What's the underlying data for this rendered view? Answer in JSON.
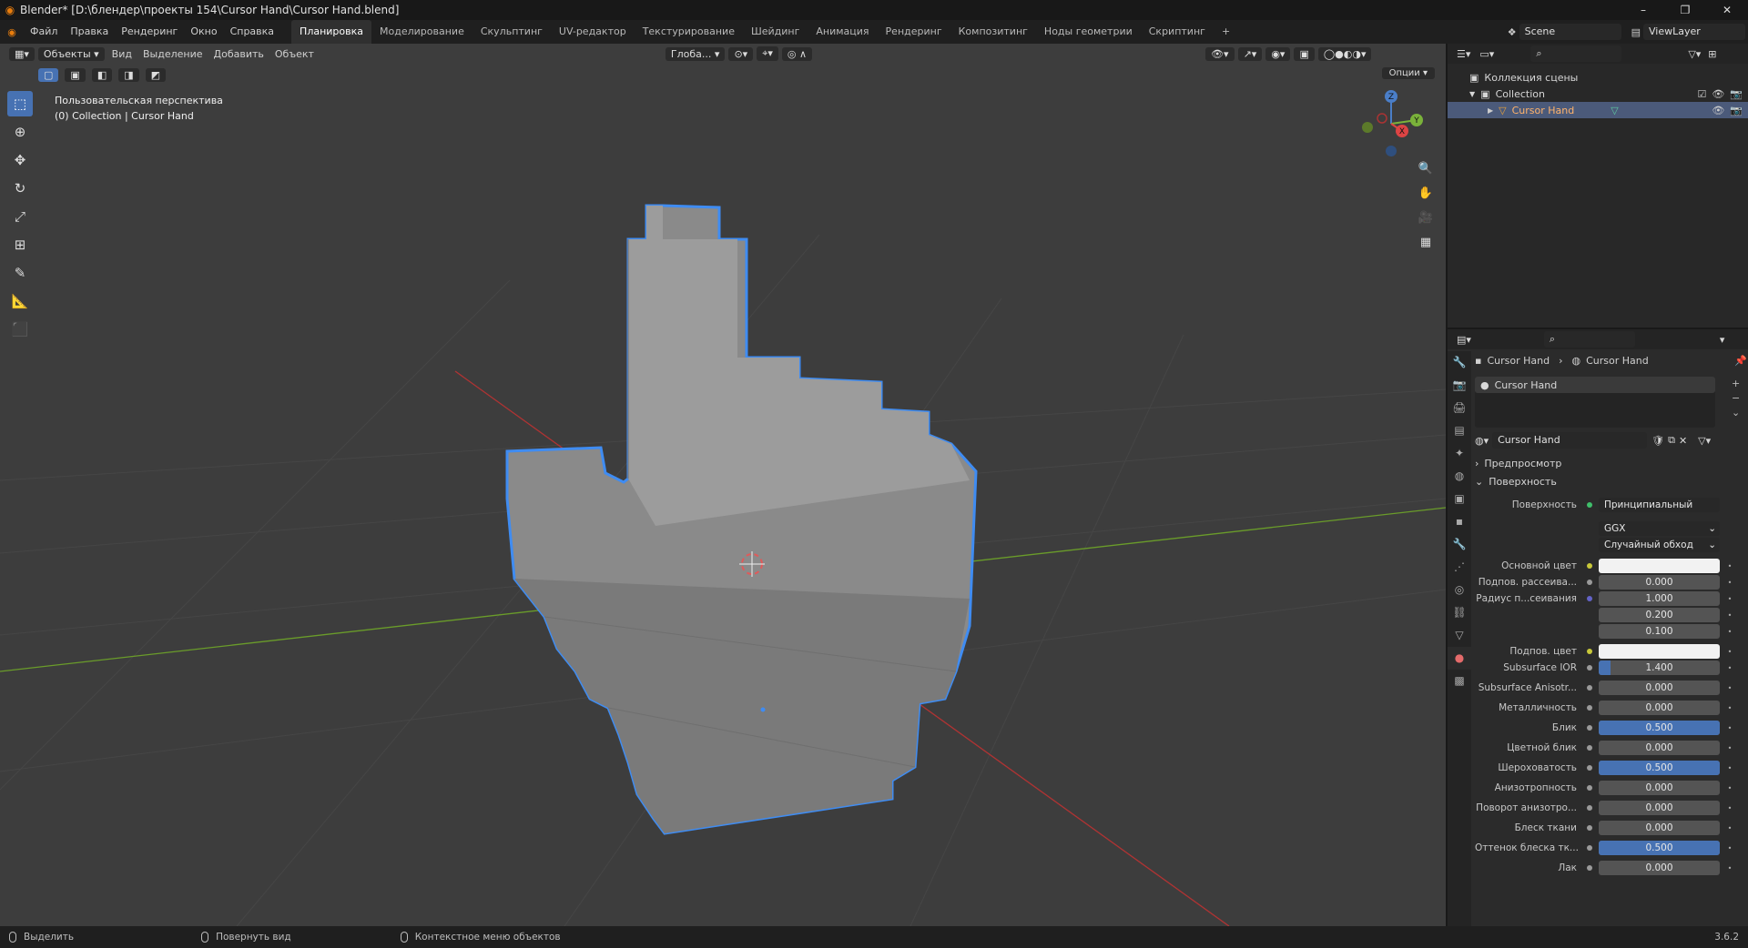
{
  "window": {
    "title": "Blender* [D:\\блендер\\проекты 154\\Cursor Hand\\Cursor Hand.blend]",
    "controls": [
      "–",
      "❐",
      "✕"
    ]
  },
  "menu": {
    "items": [
      "Файл",
      "Правка",
      "Рендеринг",
      "Окно",
      "Справка"
    ],
    "workspaces": [
      "Планировка",
      "Моделирование",
      "Скульптинг",
      "UV-редактор",
      "Текстурирование",
      "Шейдинг",
      "Анимация",
      "Рендеринг",
      "Композитинг",
      "Ноды геометрии",
      "Скриптинг",
      "+"
    ],
    "active_workspace": "Планировка",
    "scene": "Scene",
    "view_layer": "ViewLayer"
  },
  "viewport": {
    "mode": "Объекты",
    "menus": [
      "Вид",
      "Выделение",
      "Добавить",
      "Объект"
    ],
    "orientation": "Глоба...",
    "options": "Опции",
    "perspective_label": "Пользовательская перспектива",
    "collection_label": "(0) Collection | Cursor Hand",
    "gizmo": {
      "x": "X",
      "y": "Y",
      "z": "Z"
    }
  },
  "outliner": {
    "root": "Коллекция сцены",
    "collection": "Collection",
    "object": "Cursor Hand"
  },
  "properties": {
    "breadcrumb": [
      "Cursor Hand",
      "Cursor Hand"
    ],
    "slot": "Cursor Hand",
    "material_name": "Cursor Hand",
    "preview_panel": "Предпросмотр",
    "surface_panel": "Поверхность",
    "surface_label": "Поверхность",
    "surface_value": "Принципиальный BSDF",
    "distribution": "GGX",
    "subsurface_method": "Случайный обход",
    "rows": [
      {
        "label": "Основной цвет",
        "value": "",
        "type": "color",
        "color": "#f2f2f2",
        "dot": "#c9c93a"
      },
      {
        "label": "Подпов. рассеива...",
        "value": "0.000",
        "type": "num",
        "fill": 0,
        "dot": "#9a9a9a"
      },
      {
        "label": "Радиус п...сеивания",
        "value": "1.000",
        "type": "num",
        "fill": 0,
        "dot": "#6363c7"
      },
      {
        "label": "",
        "value": "0.200",
        "type": "num",
        "fill": 0,
        "dot": ""
      },
      {
        "label": "",
        "value": "0.100",
        "type": "num",
        "fill": 0,
        "dot": ""
      },
      {
        "label": "Подпов. цвет",
        "value": "",
        "type": "color",
        "color": "#f2f2f2",
        "dot": "#c9c93a"
      },
      {
        "label": "Subsurface IOR",
        "value": "1.400",
        "type": "num",
        "fill": 0.1,
        "dot": "#9a9a9a"
      },
      {
        "label": "Subsurface Anisotr...",
        "value": "0.000",
        "type": "num",
        "fill": 0,
        "dot": "#9a9a9a"
      },
      {
        "label": "Металличность",
        "value": "0.000",
        "type": "num",
        "fill": 0,
        "dot": "#9a9a9a"
      },
      {
        "label": "Блик",
        "value": "0.500",
        "type": "num",
        "fill": 1,
        "dot": "#9a9a9a"
      },
      {
        "label": "Цветной блик",
        "value": "0.000",
        "type": "num",
        "fill": 0,
        "dot": "#9a9a9a"
      },
      {
        "label": "Шероховатость",
        "value": "0.500",
        "type": "num",
        "fill": 1,
        "dot": "#9a9a9a"
      },
      {
        "label": "Анизотропность",
        "value": "0.000",
        "type": "num",
        "fill": 0,
        "dot": "#9a9a9a"
      },
      {
        "label": "Поворот анизотро...",
        "value": "0.000",
        "type": "num",
        "fill": 0,
        "dot": "#9a9a9a"
      },
      {
        "label": "Блеск ткани",
        "value": "0.000",
        "type": "num",
        "fill": 0,
        "dot": "#9a9a9a"
      },
      {
        "label": "Оттенок блеска тк...",
        "value": "0.500",
        "type": "num",
        "fill": 1,
        "dot": "#9a9a9a"
      },
      {
        "label": "Лак",
        "value": "0.000",
        "type": "num",
        "fill": 0,
        "dot": "#9a9a9a"
      }
    ]
  },
  "statusbar": {
    "select": "Выделить",
    "rotate": "Повернуть вид",
    "context": "Контекстное меню объектов",
    "version": "3.6.2"
  },
  "colors": {
    "accent": "#4772b3",
    "selection_outline": "#3f8cf2",
    "mesh": "#8a8a8a",
    "x_axis": "#b03333",
    "y_axis": "#6a9c2a"
  }
}
